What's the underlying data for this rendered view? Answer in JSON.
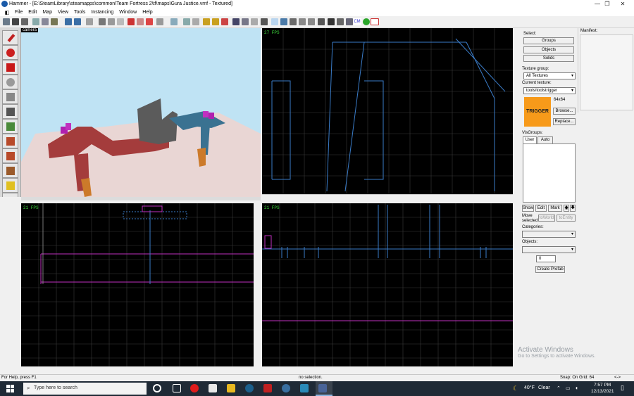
{
  "window": {
    "title": "Hammer - [E:\\SteamLibrary\\steamapps\\common\\Team Fortress 2\\tf\\maps\\Gura Justice.vmf - Textured]",
    "controls": [
      "—",
      "❐",
      "✕"
    ]
  },
  "menu": [
    "File",
    "Edit",
    "Map",
    "View",
    "Tools",
    "Instancing",
    "Window",
    "Help"
  ],
  "viewports": {
    "camera_label": "camera",
    "top_right_fps": "27 FPS",
    "bottom_left_fps": "21 FPS",
    "bottom_right_fps": "21 FPS"
  },
  "select_panel": {
    "heading": "Select:",
    "groups": "Groups",
    "objects": "Objects",
    "solids": "Solids"
  },
  "texture_panel": {
    "group_label": "Texture group:",
    "group_value": "All Textures",
    "current_label": "Current texture:",
    "current_value": "tools/toolstrigger",
    "size": "64x64",
    "swatch_text": "TRIGGER",
    "browse": "Browse...",
    "replace": "Replace..."
  },
  "visgroups": {
    "heading": "VisGroups:",
    "tab_user": "User",
    "tab_auto": "Auto",
    "show": "Show",
    "edit": "Edit",
    "mark": "Mark",
    "up": "🡅",
    "down": "🡇"
  },
  "move_panel": {
    "label": "Move\nselected:",
    "toworld": "toWorld",
    "toentity": "toEntity"
  },
  "prefab": {
    "categories_label": "Categories:",
    "objects_label": "Objects:",
    "count": "0",
    "create": "Create Prefab"
  },
  "manifest": {
    "heading": "Manifest:"
  },
  "status": {
    "help": "For Help, press F1",
    "selection": "no selection.",
    "snap": "Snap: On Grid: 64",
    "arrows": "<->"
  },
  "watermark": {
    "line1": "Activate Windows",
    "line2": "Go to Settings to activate Windows."
  },
  "taskbar": {
    "search_placeholder": "Type here to search",
    "weather_temp": "40°F",
    "weather_text": "Clear",
    "time": "7:57 PM",
    "date": "12/13/2021"
  },
  "colors": {
    "sky": "#bfe3f4",
    "ground": "#e9d6d4",
    "brush_red": "#a43c3c",
    "brush_gray": "#5b5b5b",
    "brush_blue": "#3a7291",
    "brush_orange": "#cc7a2a",
    "trigger": "#f79a1a",
    "grid_line": "#3a3a3a",
    "wire_blue": "#3a7cc8",
    "wire_magenta": "#c030c0"
  }
}
